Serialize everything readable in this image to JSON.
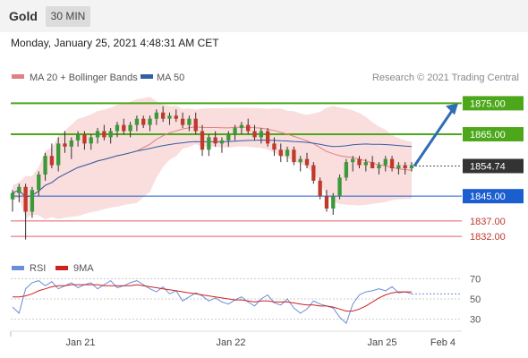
{
  "header": {
    "title": "Gold",
    "timeframe": "30 MIN",
    "datetime": "Monday, January 25, 2021 4:48:31 AM CET"
  },
  "legend": {
    "ma20": "MA 20 + Bollinger Bands",
    "ma50": "MA 50",
    "copyright": "Research © 2021 Trading Central"
  },
  "colors": {
    "candle_up": "#3a9a3a",
    "candle_down": "#c0392b",
    "bollinger_fill": "#f9d4d4",
    "ma20": "#e08080",
    "ma50": "#3060a8",
    "resistance": "#4ca81a",
    "support_blue": "#1b5ecf",
    "support_red": "#e06060",
    "last_price": "#333333",
    "arrow": "#2f6db5",
    "rsi": "#6b8ed8",
    "rsi_ma": "#cc2222"
  },
  "chart_data": {
    "type": "candlestick",
    "price_ylim": [
      1828,
      1878
    ],
    "levels": [
      {
        "value": 1875.0,
        "label": "1875.00",
        "kind": "resistance"
      },
      {
        "value": 1865.0,
        "label": "1865.00",
        "kind": "resistance"
      },
      {
        "value": 1854.74,
        "label": "1854.74",
        "kind": "last"
      },
      {
        "value": 1845.0,
        "label": "1845.00",
        "kind": "support"
      },
      {
        "value": 1837.0,
        "label": "1837.00",
        "kind": "support2"
      },
      {
        "value": 1832.0,
        "label": "1832.00",
        "kind": "support2"
      }
    ],
    "x_ticks": [
      "Jan 21",
      "Jan 22",
      "Jan 25",
      "Feb 4"
    ],
    "candles": [
      [
        1844,
        1847,
        1840,
        1846
      ],
      [
        1846,
        1849,
        1843,
        1848
      ],
      [
        1848,
        1849,
        1831,
        1840
      ],
      [
        1840,
        1848,
        1838,
        1847
      ],
      [
        1847,
        1853,
        1845,
        1852
      ],
      [
        1852,
        1859,
        1850,
        1858
      ],
      [
        1858,
        1862,
        1854,
        1855
      ],
      [
        1855,
        1864,
        1853,
        1862
      ],
      [
        1862,
        1866,
        1859,
        1861
      ],
      [
        1861,
        1864,
        1857,
        1863
      ],
      [
        1863,
        1866,
        1861,
        1865
      ],
      [
        1865,
        1866,
        1860,
        1862
      ],
      [
        1862,
        1865,
        1860,
        1864
      ],
      [
        1864,
        1867,
        1862,
        1866
      ],
      [
        1866,
        1868,
        1863,
        1864
      ],
      [
        1864,
        1867,
        1862,
        1866
      ],
      [
        1866,
        1869,
        1864,
        1868
      ],
      [
        1868,
        1870,
        1865,
        1866
      ],
      [
        1866,
        1869,
        1864,
        1868
      ],
      [
        1868,
        1871,
        1866,
        1870
      ],
      [
        1870,
        1871,
        1867,
        1868
      ],
      [
        1868,
        1871,
        1866,
        1870
      ],
      [
        1870,
        1873,
        1868,
        1872
      ],
      [
        1872,
        1874,
        1869,
        1870
      ],
      [
        1870,
        1872,
        1868,
        1871
      ],
      [
        1871,
        1873,
        1869,
        1870
      ],
      [
        1870,
        1872,
        1867,
        1868
      ],
      [
        1868,
        1871,
        1866,
        1870
      ],
      [
        1870,
        1872,
        1865,
        1866
      ],
      [
        1866,
        1868,
        1858,
        1860
      ],
      [
        1860,
        1865,
        1858,
        1864
      ],
      [
        1864,
        1866,
        1861,
        1862
      ],
      [
        1862,
        1864,
        1859,
        1863
      ],
      [
        1863,
        1866,
        1861,
        1865
      ],
      [
        1865,
        1868,
        1863,
        1867
      ],
      [
        1867,
        1869,
        1865,
        1868
      ],
      [
        1868,
        1870,
        1865,
        1866
      ],
      [
        1866,
        1868,
        1863,
        1864
      ],
      [
        1864,
        1867,
        1862,
        1866
      ],
      [
        1866,
        1867,
        1861,
        1862
      ],
      [
        1862,
        1864,
        1858,
        1860
      ],
      [
        1860,
        1862,
        1856,
        1858
      ],
      [
        1858,
        1861,
        1856,
        1860
      ],
      [
        1860,
        1861,
        1855,
        1856
      ],
      [
        1856,
        1858,
        1853,
        1857
      ],
      [
        1857,
        1859,
        1854,
        1855
      ],
      [
        1855,
        1856,
        1849,
        1850
      ],
      [
        1850,
        1851,
        1844,
        1845
      ],
      [
        1845,
        1847,
        1840,
        1841
      ],
      [
        1841,
        1846,
        1839,
        1845
      ],
      [
        1845,
        1852,
        1844,
        1851
      ],
      [
        1851,
        1857,
        1850,
        1856
      ],
      [
        1856,
        1858,
        1853,
        1857
      ],
      [
        1857,
        1858,
        1854,
        1855
      ],
      [
        1855,
        1857,
        1853,
        1856
      ],
      [
        1856,
        1858,
        1854,
        1854
      ],
      [
        1854,
        1856,
        1852,
        1855
      ],
      [
        1855,
        1858,
        1853,
        1857
      ],
      [
        1857,
        1858,
        1853,
        1854
      ],
      [
        1854,
        1856,
        1852,
        1855
      ],
      [
        1855,
        1856,
        1852,
        1854
      ],
      [
        1854,
        1856,
        1853,
        1855
      ]
    ],
    "rsi_axis": [
      70,
      50,
      30
    ],
    "rsi_ylim": [
      20,
      80
    ],
    "rsi_label": "RSI",
    "rsi_ma_label": "9MA",
    "rsi": [
      42,
      36,
      60,
      66,
      68,
      63,
      67,
      60,
      63,
      66,
      61,
      64,
      66,
      60,
      64,
      68,
      61,
      63,
      66,
      68,
      64,
      60,
      57,
      62,
      55,
      58,
      48,
      52,
      56,
      53,
      48,
      51,
      47,
      45,
      49,
      52,
      47,
      43,
      50,
      54,
      46,
      44,
      50,
      41,
      36,
      40,
      48,
      45,
      43,
      41,
      32,
      26,
      45,
      54,
      57,
      58,
      60,
      58,
      62,
      56,
      57,
      55
    ],
    "rsi_ma": [
      52,
      52,
      53,
      55,
      58,
      60,
      62,
      63,
      63,
      64,
      64,
      64,
      64,
      64,
      63,
      63,
      63,
      63,
      63,
      64,
      63,
      62,
      61,
      60,
      59,
      58,
      57,
      56,
      55,
      54,
      53,
      52,
      51,
      50,
      49,
      49,
      48,
      47,
      48,
      48,
      47,
      47,
      47,
      46,
      45,
      44,
      44,
      43,
      43,
      42,
      40,
      38,
      38,
      40,
      43,
      47,
      51,
      54,
      56,
      57,
      57,
      57
    ]
  }
}
